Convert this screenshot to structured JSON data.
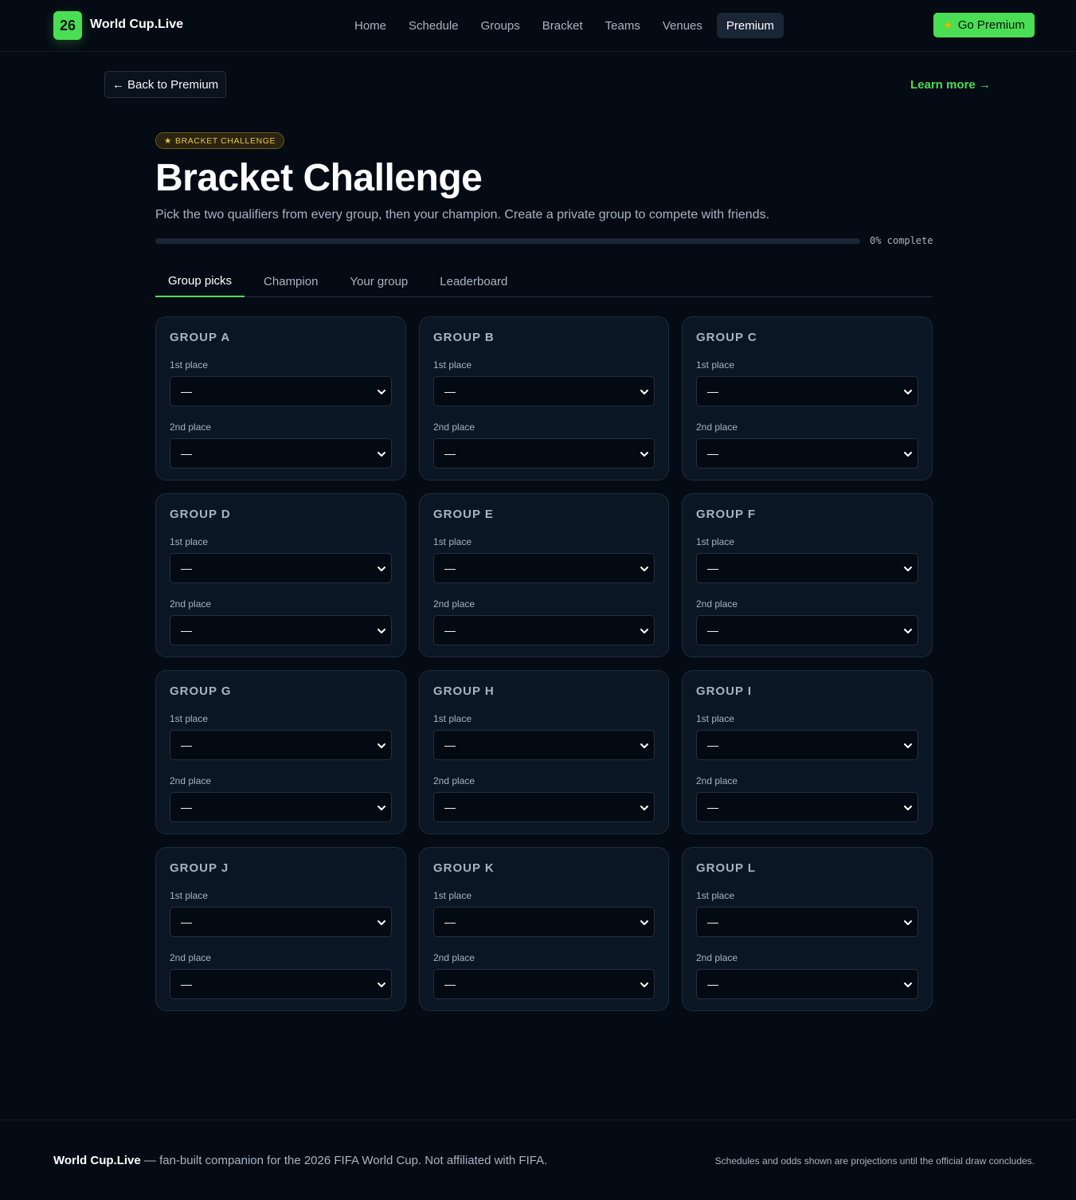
{
  "brand": {
    "badge": "26",
    "name": "World Cup.Live"
  },
  "nav": {
    "links": [
      "Home",
      "Schedule",
      "Groups",
      "Bracket",
      "Teams",
      "Venues",
      "Premium"
    ],
    "active": "Premium",
    "cta": {
      "icon": "star-icon",
      "label": "Go Premium"
    }
  },
  "actions": {
    "back": "← Back to Premium",
    "learn_more": "Learn more →"
  },
  "hero": {
    "badge_icon": "★",
    "badge": "BRACKET CHALLENGE",
    "title": "Bracket Challenge",
    "subtitle": "Pick the two qualifiers from every group, then your champion. Create a private group to compete with friends.",
    "progress_percent": 0,
    "progress_text": "0% complete"
  },
  "tabs": [
    "Group picks",
    "Champion",
    "Your group",
    "Leaderboard"
  ],
  "active_tab": "Group picks",
  "groups": [
    {
      "title": "GROUP A",
      "first_label": "1st place",
      "first_value": "—",
      "second_label": "2nd place",
      "second_value": "—"
    },
    {
      "title": "GROUP B",
      "first_label": "1st place",
      "first_value": "—",
      "second_label": "2nd place",
      "second_value": "—"
    },
    {
      "title": "GROUP C",
      "first_label": "1st place",
      "first_value": "—",
      "second_label": "2nd place",
      "second_value": "—"
    },
    {
      "title": "GROUP D",
      "first_label": "1st place",
      "first_value": "—",
      "second_label": "2nd place",
      "second_value": "—"
    },
    {
      "title": "GROUP E",
      "first_label": "1st place",
      "first_value": "—",
      "second_label": "2nd place",
      "second_value": "—"
    },
    {
      "title": "GROUP F",
      "first_label": "1st place",
      "first_value": "—",
      "second_label": "2nd place",
      "second_value": "—"
    },
    {
      "title": "GROUP G",
      "first_label": "1st place",
      "first_value": "—",
      "second_label": "2nd place",
      "second_value": "—"
    },
    {
      "title": "GROUP H",
      "first_label": "1st place",
      "first_value": "—",
      "second_label": "2nd place",
      "second_value": "—"
    },
    {
      "title": "GROUP I",
      "first_label": "1st place",
      "first_value": "—",
      "second_label": "2nd place",
      "second_value": "—"
    },
    {
      "title": "GROUP J",
      "first_label": "1st place",
      "first_value": "—",
      "second_label": "2nd place",
      "second_value": "—"
    },
    {
      "title": "GROUP K",
      "first_label": "1st place",
      "first_value": "—",
      "second_label": "2nd place",
      "second_value": "—"
    },
    {
      "title": "GROUP L",
      "first_label": "1st place",
      "first_value": "—",
      "second_label": "2nd place",
      "second_value": "—"
    }
  ],
  "footer": {
    "brand": "World Cup.Live",
    "tagline": " — fan-built companion for the 2026 FIFA World Cup. Not affiliated with FIFA.",
    "note": "Schedules and odds shown are projections until the official draw concludes."
  },
  "colors": {
    "accent": "#4ade54",
    "background": "#050b14",
    "card": "#0b1625",
    "badge_gold": "#e8c547"
  }
}
